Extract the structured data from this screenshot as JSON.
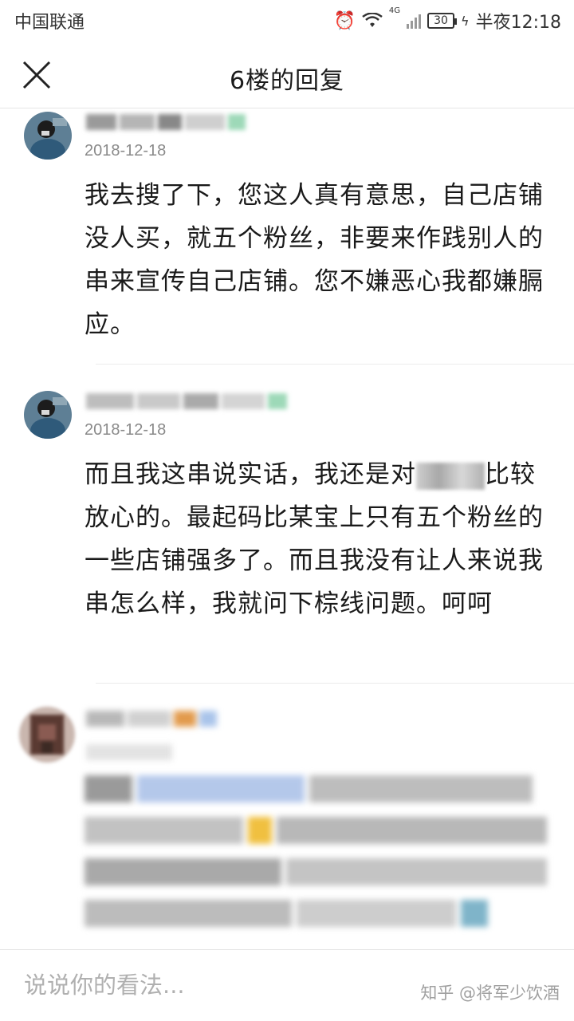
{
  "status_bar": {
    "carrier": "中国联通",
    "network": "4G",
    "battery": "30",
    "time": "半夜12:18"
  },
  "header": {
    "title": "6楼的回复"
  },
  "comments": [
    {
      "date": "2018-12-18",
      "text": "我去搜了下，您这人真有意思，自己店铺没人买，就五个粉丝，非要来作践别人的串来宣传自己店铺。您不嫌恶心我都嫌膈应。"
    },
    {
      "date": "2018-12-18",
      "text": "而且我这串说实话，我还是对",
      "text_after": "比较放心的。最起码比某宝上只有五个粉丝的一些店铺强多了。而且我没有让人来说我串怎么样，我就问下棕线问题。呵呵"
    }
  ],
  "bottom_bar": {
    "input_placeholder": "说说你的看法...",
    "watermark": "知乎 @将军少饮酒"
  },
  "colors": {
    "text_primary": "#1a1a1a",
    "text_secondary": "#8a8a8a",
    "divider": "#ececec"
  }
}
